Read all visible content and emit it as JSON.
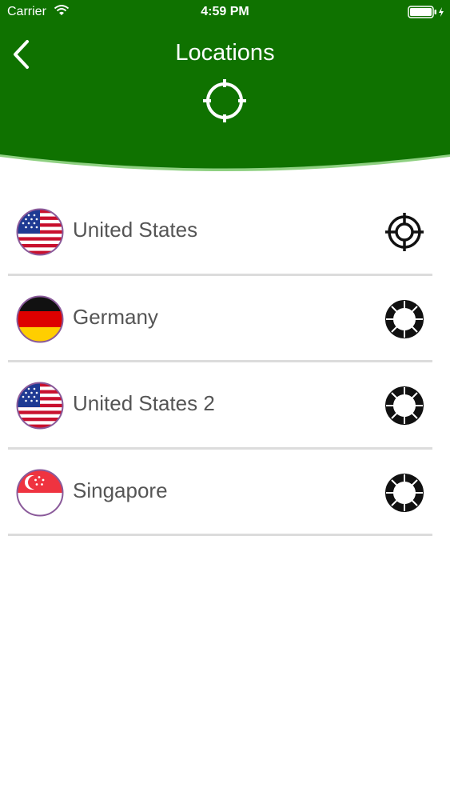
{
  "status_bar": {
    "carrier": "Carrier",
    "time": "4:59 PM"
  },
  "header": {
    "title": "Locations",
    "background": "#0f7200"
  },
  "locations": [
    {
      "name": "United States",
      "flag": "us-flag",
      "status": "selected-target-icon"
    },
    {
      "name": "Germany",
      "flag": "germany-flag",
      "status": "server-ring-icon"
    },
    {
      "name": "United States 2",
      "flag": "us-flag",
      "status": "server-ring-icon"
    },
    {
      "name": "Singapore",
      "flag": "singapore-flag",
      "status": "server-ring-icon"
    }
  ]
}
